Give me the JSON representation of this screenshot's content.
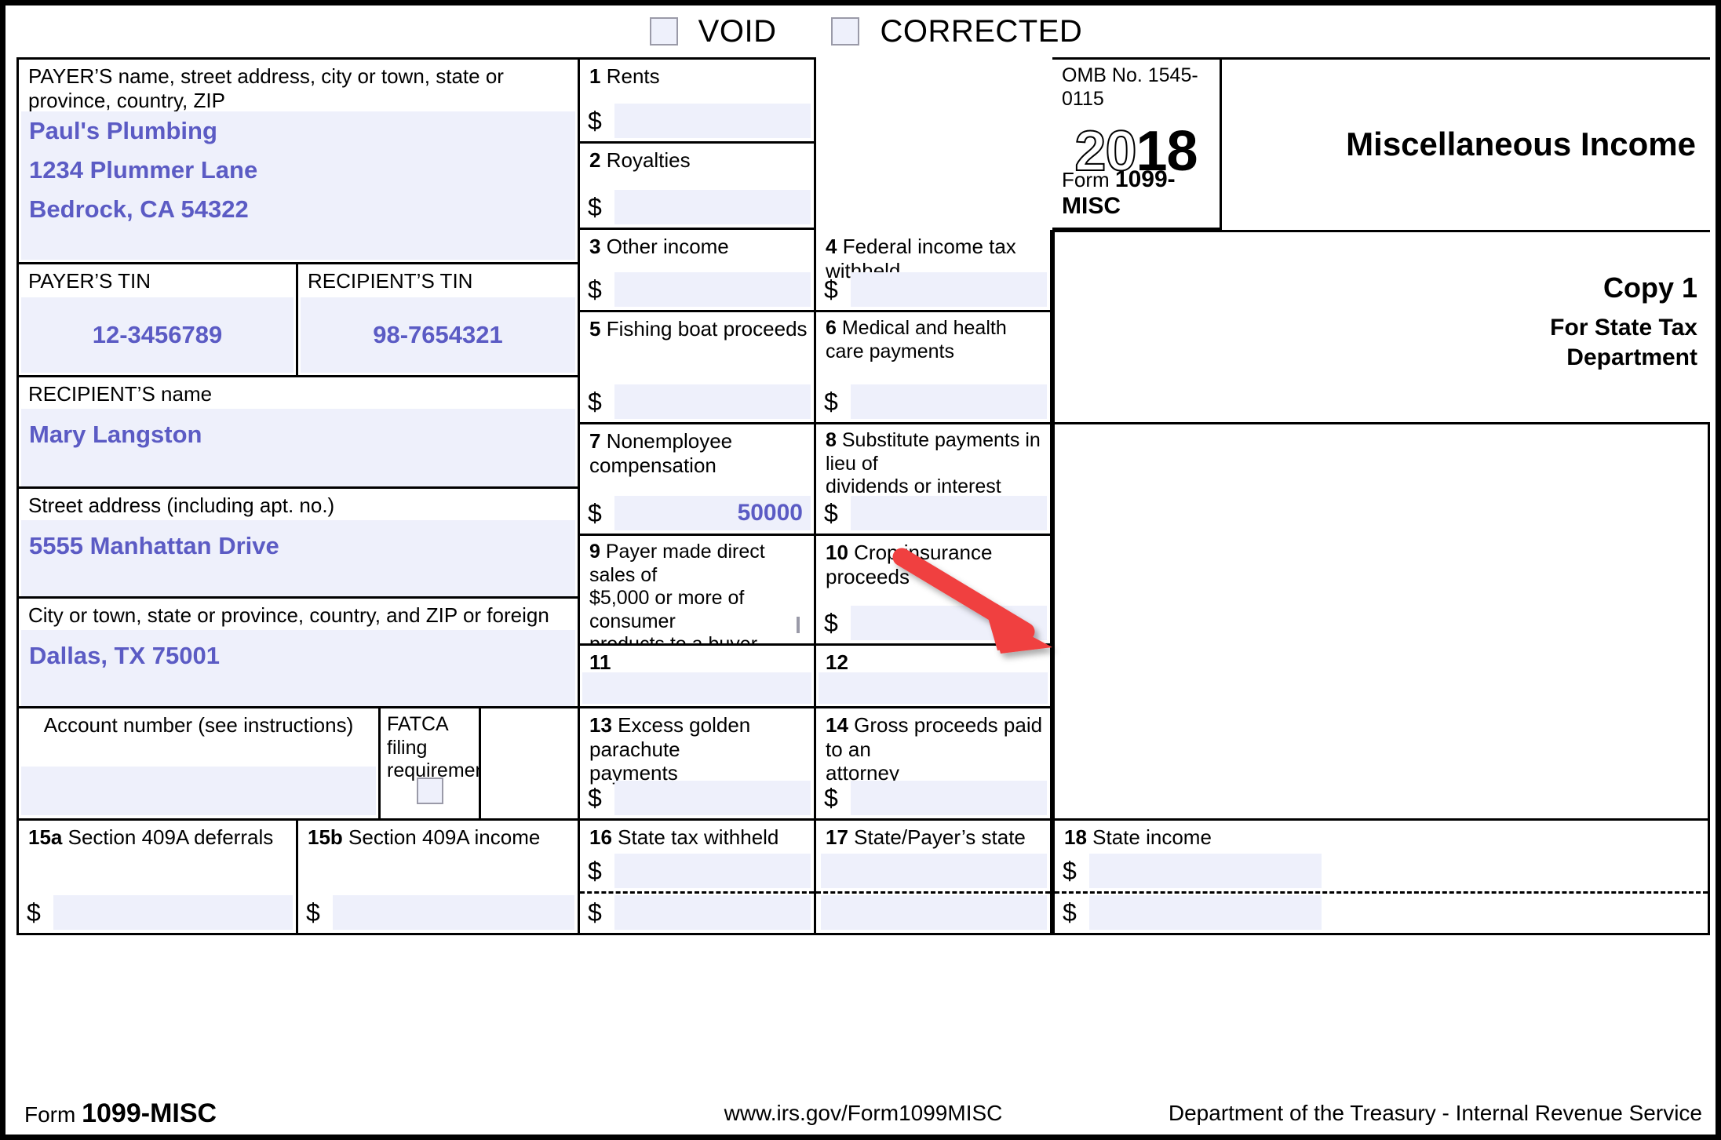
{
  "header": {
    "void_label": "VOID",
    "corrected_label": "CORRECTED"
  },
  "payer": {
    "caption": "PAYER’S name, street address, city or town, state or province, country, ZIP\nor foreign postal code, and telephone no.",
    "value": "Paul's Plumbing\n1234 Plummer Lane\nBedrock, CA 54322"
  },
  "payer_tin": {
    "caption": "PAYER’S TIN",
    "value": "12-3456789"
  },
  "recipient_tin": {
    "caption": "RECIPIENT’S TIN",
    "value": "98-7654321"
  },
  "recipient": {
    "name_caption": "RECIPIENT’S name",
    "name_value": "Mary Langston",
    "street_caption": "Street address (including apt. no.)",
    "street_value": "5555 Manhattan Drive",
    "city_caption": "City or town, state or province, country, and ZIP or foreign postal code",
    "city_value": "Dallas, TX 75001"
  },
  "account": {
    "caption": "Account number (see instructions)",
    "value": ""
  },
  "fatca": {
    "caption": "FATCA filing\nrequirement",
    "checked": false
  },
  "omb": {
    "label": "OMB No. 1545-0115",
    "year_hollow": "20",
    "year_solid": "18",
    "form_prefix": "Form",
    "form_name": "1099-MISC"
  },
  "title": {
    "main": "Miscellaneous\nIncome",
    "copy": "Copy 1",
    "copy_sub": "For State Tax\nDepartment"
  },
  "boxes": [
    {
      "num": "1",
      "label": "Rents",
      "value": "",
      "dollar": true
    },
    {
      "num": "2",
      "label": "Royalties",
      "value": "",
      "dollar": true
    },
    {
      "num": "3",
      "label": "Other income",
      "value": "",
      "dollar": true
    },
    {
      "num": "4",
      "label": "Federal income tax withheld",
      "value": "",
      "dollar": true
    },
    {
      "num": "5",
      "label": "Fishing boat proceeds",
      "value": "",
      "dollar": true
    },
    {
      "num": "6",
      "label": "Medical and health care payments",
      "value": "",
      "dollar": true
    },
    {
      "num": "7",
      "label": "Nonemployee compensation",
      "value": "50000",
      "dollar": true
    },
    {
      "num": "8",
      "label": "Substitute payments in lieu of\ndividends or interest",
      "value": "",
      "dollar": true
    },
    {
      "num": "9",
      "label": "Payer made direct sales of\n$5,000 or more of consumer\nproducts to a buyer\n(recipient) for resale ▶",
      "value": "",
      "dollar": false,
      "checkbox": true
    },
    {
      "num": "10",
      "label": "Crop insurance proceeds",
      "value": "",
      "dollar": true
    },
    {
      "num": "11",
      "label": "",
      "value": "",
      "dollar": false
    },
    {
      "num": "12",
      "label": "",
      "value": "",
      "dollar": false
    },
    {
      "num": "13",
      "label": "Excess golden parachute\npayments",
      "value": "",
      "dollar": true
    },
    {
      "num": "14",
      "label": "Gross proceeds paid to an\nattorney",
      "value": "",
      "dollar": true
    },
    {
      "num": "15a",
      "label": "Section 409A deferrals",
      "value": "",
      "dollar": true
    },
    {
      "num": "15b",
      "label": "Section 409A income",
      "value": "",
      "dollar": true
    },
    {
      "num": "16",
      "label": "State tax withheld",
      "value": "",
      "value2": "",
      "dollar": true,
      "split": true
    },
    {
      "num": "17",
      "label": "State/Payer’s state no.",
      "value": "",
      "value2": "",
      "dollar": false,
      "split": true
    },
    {
      "num": "18",
      "label": "State income",
      "value": "",
      "value2": "",
      "dollar": true,
      "split": true
    }
  ],
  "footer": {
    "form_prefix": "Form",
    "form_name": "1099-MISC",
    "url": "www.irs.gov/Form1099MISC",
    "agency": "Department of the Treasury - Internal Revenue Service"
  },
  "annotation": {
    "type": "arrow",
    "color": "#f04040",
    "points_to": "box-7-amount"
  },
  "colors": {
    "entry_fill": "#eef0fb",
    "user_text": "#5b5bc4",
    "rule": "#000000",
    "arrow": "#f04040"
  }
}
